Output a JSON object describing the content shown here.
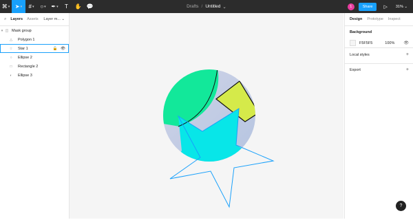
{
  "toolbar": {
    "menu_icon": "figma-menu-icon",
    "tools": [
      "move",
      "frame",
      "shape",
      "pen",
      "text",
      "hand",
      "comment"
    ]
  },
  "title": {
    "folder": "Drafts",
    "separator": "/",
    "file": "Untitled",
    "caret": "⌄"
  },
  "topright": {
    "avatar": "1",
    "share": "Share",
    "zoom": "31%"
  },
  "left_panel": {
    "tabs": [
      "Layers",
      "Assets"
    ],
    "page": "Layer m...",
    "layers": [
      {
        "name": "Mask group",
        "icon": "▾"
      },
      {
        "name": "Polygon 1",
        "icon": "△"
      },
      {
        "name": "Star 1",
        "icon": "☆"
      },
      {
        "name": "Ellipse 2",
        "icon": "○"
      },
      {
        "name": "Rectangle 2",
        "icon": "□"
      },
      {
        "name": "Ellipse 3",
        "icon": "◐"
      }
    ]
  },
  "right_panel": {
    "tabs": [
      "Design",
      "Prototype",
      "Inspect"
    ],
    "background_label": "Background",
    "bg_hex": "F5F5F5",
    "bg_opacity": "100%",
    "local_styles": "Local styles",
    "export": "Export",
    "add": "+"
  },
  "help": "?",
  "colors": {
    "accent": "#18a0fb",
    "green": "#10e89a",
    "yellow": "#d4ea4b",
    "cyan": "#08e6e8",
    "lavender": "#b8b8d8"
  }
}
